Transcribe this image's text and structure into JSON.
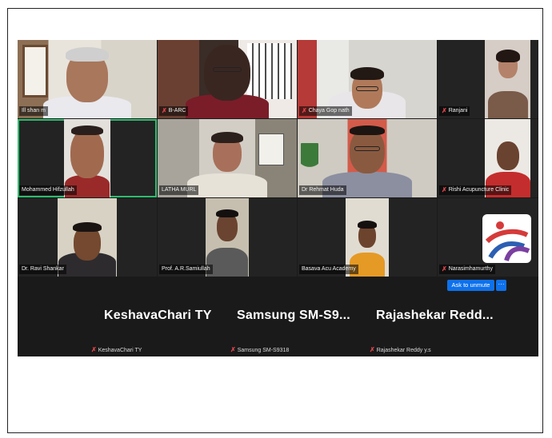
{
  "tiles": [
    {
      "name": "Ill shan m"
    },
    {
      "name": "B-ARC"
    },
    {
      "name": "Chaya Gop nath"
    },
    {
      "name": "Ranjani"
    },
    {
      "name": "Mohammed Hifzullah"
    },
    {
      "name": "LATHA MURL"
    },
    {
      "name": "Dr Rehmat Huda"
    },
    {
      "name": "Rishi Acupuncture Clinic"
    },
    {
      "name": "Dr. Ravi Shankar"
    },
    {
      "name": "Prof. A.R.Samiullah"
    },
    {
      "name": "Basava Acu Academy"
    },
    {
      "name": "Narasimhamurthy"
    }
  ],
  "audio_participants": [
    {
      "display": "KeshavaChari TY",
      "label": "KeshavaChari TY"
    },
    {
      "display": "Samsung  SM-S9...",
      "label": "Samsung SM-S9318"
    },
    {
      "display": "Rajashekar  Redd...",
      "label": "Rajashekar Reddy y.s"
    }
  ],
  "controls": {
    "ask_to_unmute": "Ask to unmute",
    "more": "···"
  },
  "colors": {
    "meeting_background": "#1a1a1a",
    "tile_background": "#232323",
    "active_speaker_border": "#2dbd6e",
    "mute_icon": "#e0464b",
    "button_blue": "#0e71eb"
  },
  "icons": {
    "muted": "mic-off-icon"
  }
}
